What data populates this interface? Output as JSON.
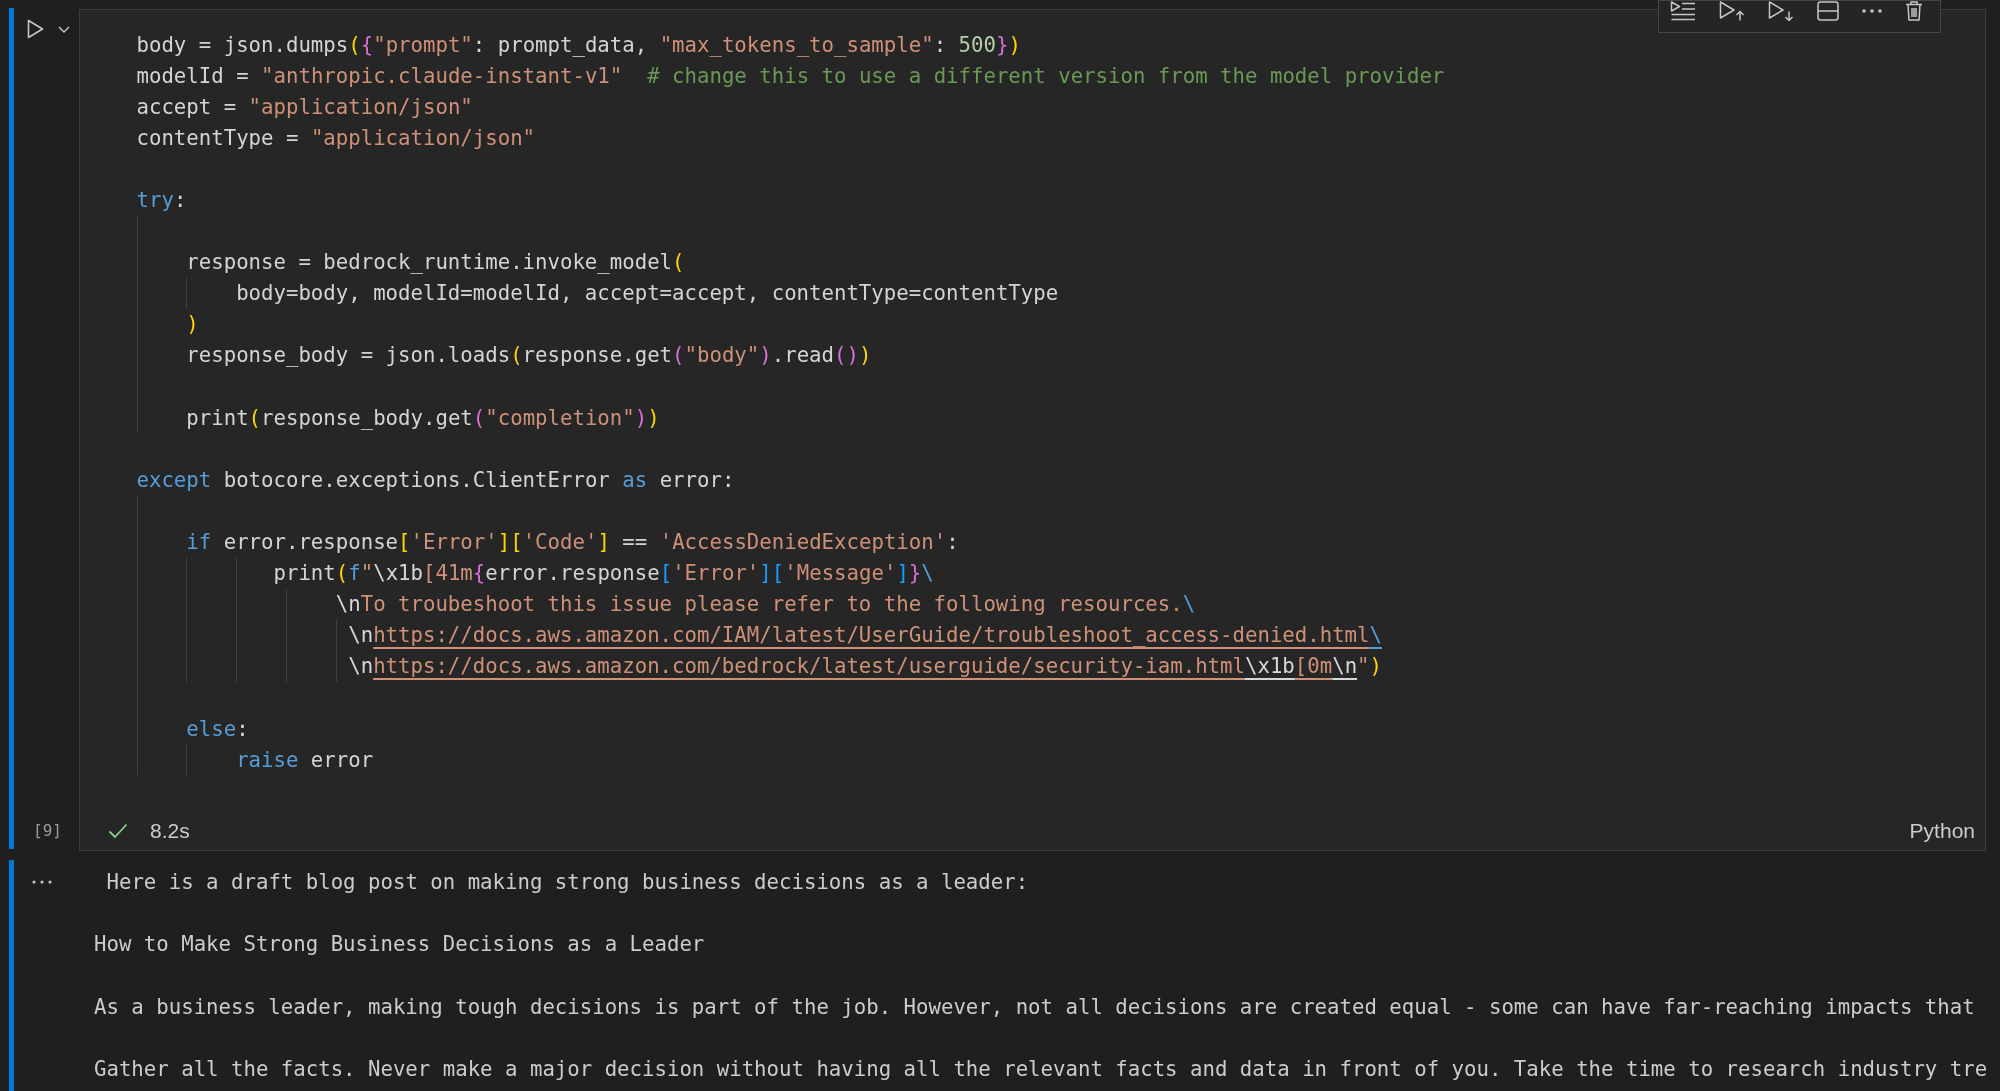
{
  "cell": {
    "selected": true,
    "source": [
      {
        "kind": "code",
        "tokens": [
          {
            "kind": "plain",
            "text": "body = json.dumps"
          },
          {
            "kind": "paren1",
            "text": "("
          },
          {
            "kind": "paren2",
            "text": "{"
          },
          {
            "kind": "string",
            "text": "\"prompt\""
          },
          {
            "kind": "plain",
            "text": ": prompt_data, "
          },
          {
            "kind": "string",
            "text": "\"max_tokens_to_sample\""
          },
          {
            "kind": "plain",
            "text": ": "
          },
          {
            "kind": "number",
            "text": "500"
          },
          {
            "kind": "paren2",
            "text": "}"
          },
          {
            "kind": "paren1",
            "text": ")"
          }
        ]
      },
      {
        "kind": "code",
        "tokens": [
          {
            "kind": "plain",
            "text": "modelId = "
          },
          {
            "kind": "string",
            "text": "\"anthropic.claude-instant-v1\""
          },
          {
            "kind": "comment",
            "text": "  # change this to use a different version from the model provider"
          }
        ]
      },
      {
        "kind": "code",
        "tokens": [
          {
            "kind": "plain",
            "text": "accept = "
          },
          {
            "kind": "string",
            "text": "\"application/json\""
          }
        ]
      },
      {
        "kind": "code",
        "tokens": [
          {
            "kind": "plain",
            "text": "contentType = "
          },
          {
            "kind": "string",
            "text": "\"application/json\""
          }
        ]
      },
      {
        "kind": "blank"
      },
      {
        "kind": "code",
        "tokens": [
          {
            "kind": "keyword",
            "text": "try"
          },
          {
            "kind": "plain",
            "text": ":"
          }
        ]
      },
      {
        "kind": "blank"
      },
      {
        "kind": "code",
        "tokens": [
          {
            "kind": "plain",
            "text": "    response = bedrock_runtime.invoke_model"
          },
          {
            "kind": "paren1",
            "text": "("
          }
        ]
      },
      {
        "kind": "code",
        "tokens": [
          {
            "kind": "plain",
            "text": "        body=body, modelId=modelId, accept=accept, contentType=contentType"
          }
        ]
      },
      {
        "kind": "code",
        "tokens": [
          {
            "kind": "paren1",
            "text": "    )"
          }
        ]
      },
      {
        "kind": "code",
        "tokens": [
          {
            "kind": "plain",
            "text": "    response_body = json.loads"
          },
          {
            "kind": "paren1",
            "text": "("
          },
          {
            "kind": "plain",
            "text": "response.get"
          },
          {
            "kind": "paren2",
            "text": "("
          },
          {
            "kind": "string",
            "text": "\"body\""
          },
          {
            "kind": "paren2",
            "text": ")"
          },
          {
            "kind": "plain",
            "text": ".read"
          },
          {
            "kind": "paren2",
            "text": "()"
          },
          {
            "kind": "paren1",
            "text": ")"
          }
        ]
      },
      {
        "kind": "blank"
      },
      {
        "kind": "code",
        "tokens": [
          {
            "kind": "plain",
            "text": "    print"
          },
          {
            "kind": "paren1",
            "text": "("
          },
          {
            "kind": "plain",
            "text": "response_body.get"
          },
          {
            "kind": "paren2",
            "text": "("
          },
          {
            "kind": "string",
            "text": "\"completion\""
          },
          {
            "kind": "paren2",
            "text": ")"
          },
          {
            "kind": "paren1",
            "text": ")"
          }
        ]
      },
      {
        "kind": "blank"
      },
      {
        "kind": "code",
        "tokens": [
          {
            "kind": "keyword",
            "text": "except"
          },
          {
            "kind": "plain",
            "text": " botocore.exceptions.ClientError "
          },
          {
            "kind": "keyword",
            "text": "as"
          },
          {
            "kind": "plain",
            "text": " error:"
          }
        ]
      },
      {
        "kind": "blank"
      },
      {
        "kind": "code",
        "tokens": [
          {
            "kind": "keyword",
            "text": "    if"
          },
          {
            "kind": "plain",
            "text": " error.response"
          },
          {
            "kind": "paren1",
            "text": "["
          },
          {
            "kind": "string",
            "text": "'Error'"
          },
          {
            "kind": "paren1",
            "text": "]"
          },
          {
            "kind": "paren1",
            "text": "["
          },
          {
            "kind": "string",
            "text": "'Code'"
          },
          {
            "kind": "paren1",
            "text": "]"
          },
          {
            "kind": "plain",
            "text": " == "
          },
          {
            "kind": "string",
            "text": "'AccessDeniedException'"
          },
          {
            "kind": "plain",
            "text": ":"
          }
        ]
      },
      {
        "kind": "code",
        "tokens": [
          {
            "kind": "plain",
            "text": "           print"
          },
          {
            "kind": "paren1",
            "text": "("
          },
          {
            "kind": "prefix",
            "text": "f"
          },
          {
            "kind": "string",
            "text": "\""
          },
          {
            "kind": "escape",
            "text": "\\x1b"
          },
          {
            "kind": "string",
            "text": "[41m"
          },
          {
            "kind": "paren2",
            "text": "{"
          },
          {
            "kind": "plain",
            "text": "error.response"
          },
          {
            "kind": "paren3",
            "text": "["
          },
          {
            "kind": "string",
            "text": "'Error'"
          },
          {
            "kind": "paren3",
            "text": "]"
          },
          {
            "kind": "paren3",
            "text": "["
          },
          {
            "kind": "string",
            "text": "'Message'"
          },
          {
            "kind": "paren3",
            "text": "]"
          },
          {
            "kind": "paren2",
            "text": "}"
          },
          {
            "kind": "continuation",
            "text": "\\"
          }
        ]
      },
      {
        "kind": "code",
        "tokens": [
          {
            "kind": "escape",
            "text": "                \\n"
          },
          {
            "kind": "string",
            "text": "To troubeshoot this issue please refer to the following resources."
          },
          {
            "kind": "continuation",
            "text": "\\"
          }
        ]
      },
      {
        "kind": "code",
        "tokens": [
          {
            "kind": "escape",
            "text": "                 \\n"
          },
          {
            "kind": "link",
            "parts": [
              {
                "kind": "string",
                "text": "https://docs.aws.amazon.com/IAM/latest/UserGuide/troubleshoot_access-denied.html"
              },
              {
                "kind": "continuation",
                "text": "\\"
              }
            ]
          }
        ]
      },
      {
        "kind": "code",
        "tokens": [
          {
            "kind": "escape",
            "text": "                 \\n"
          },
          {
            "kind": "link",
            "parts": [
              {
                "kind": "string",
                "text": "https://docs.aws.amazon.com/bedrock/latest/userguide/security-iam.html"
              },
              {
                "kind": "escape",
                "text": "\\x1b"
              },
              {
                "kind": "string",
                "text": "[0m"
              },
              {
                "kind": "escape",
                "text": "\\n"
              }
            ]
          },
          {
            "kind": "string",
            "text": "\""
          },
          {
            "kind": "paren1",
            "text": ")"
          }
        ]
      },
      {
        "kind": "blank"
      },
      {
        "kind": "code",
        "tokens": [
          {
            "kind": "keyword",
            "text": "    else"
          },
          {
            "kind": "plain",
            "text": ":"
          }
        ]
      },
      {
        "kind": "code",
        "tokens": [
          {
            "kind": "keyword",
            "text": "        raise"
          },
          {
            "kind": "plain",
            "text": " error"
          }
        ]
      }
    ],
    "execution_count": "[9]",
    "succeeded": true,
    "duration": "8.2s",
    "language": "Python",
    "output": [
      " Here is a draft blog post on making strong business decisions as a leader:",
      "How to Make Strong Business Decisions as a Leader",
      "As a business leader, making tough decisions is part of the job. However, not all decisions are created equal - some can have far-reaching impacts that",
      "Gather all the facts. Never make a major decision without having all the relevant facts and data in front of you. Take the time to research industry tre"
    ]
  }
}
